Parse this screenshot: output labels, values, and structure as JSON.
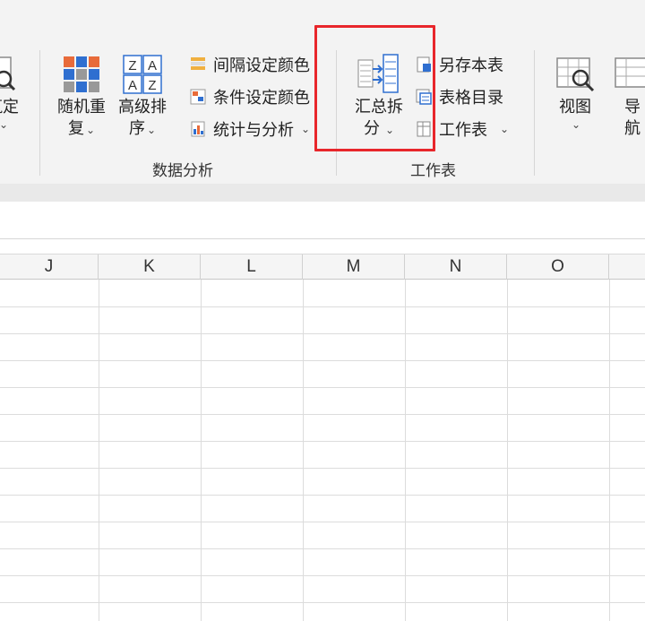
{
  "ribbon": {
    "partial_left_label": "筑定",
    "random_repeat": {
      "line1": "随机重",
      "line2": "复"
    },
    "advanced_sort": {
      "line1": "高级排",
      "line2": "序"
    },
    "interval_color": "间隔设定颜色",
    "condition_color": "条件设定颜色",
    "stats_analysis": "统计与分析",
    "data_group_label": "数据分析",
    "summary_split": {
      "line1": "汇总拆",
      "line2": "分"
    },
    "save_sheet": "另存本表",
    "table_toc": "表格目录",
    "worksheet": "工作表",
    "sheet_group_label": "工作表",
    "view": "视图",
    "nav_partial": {
      "line1": "导",
      "line2": "航"
    },
    "caret": "⌄"
  },
  "columns": [
    "J",
    "K",
    "L",
    "M",
    "N",
    "O"
  ],
  "colors": {
    "highlight": "#e8262b",
    "accent_blue": "#2f6fd0"
  }
}
